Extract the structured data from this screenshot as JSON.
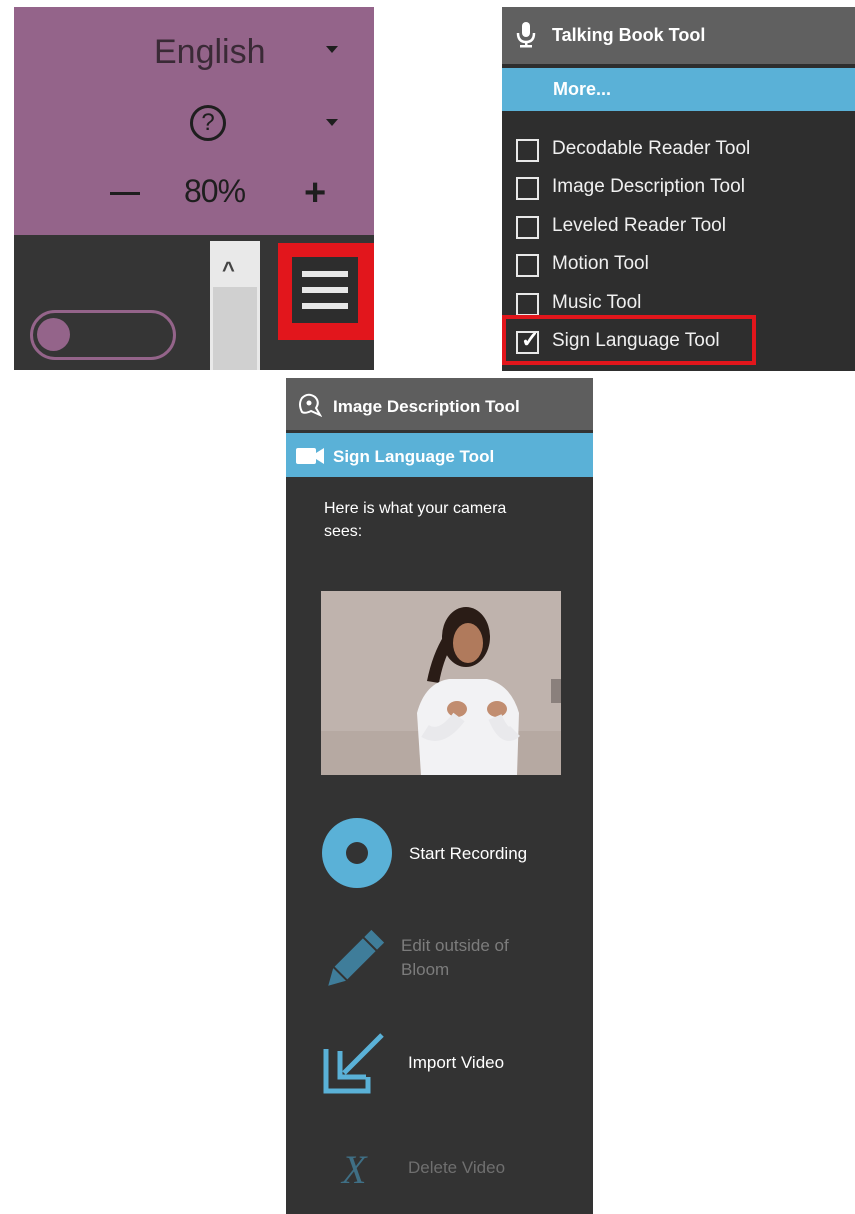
{
  "language_panel": {
    "language": "English",
    "help_glyph": "?",
    "zoom_minus": "—",
    "zoom_level": "80%",
    "zoom_plus": "+",
    "scroll_up_glyph": "^"
  },
  "tools_menu": {
    "header": "Talking Book Tool",
    "more": "More...",
    "items": [
      {
        "label": "Decodable Reader Tool",
        "checked": false
      },
      {
        "label": "Image Description Tool",
        "checked": false
      },
      {
        "label": "Leveled Reader Tool",
        "checked": false
      },
      {
        "label": "Motion Tool",
        "checked": false
      },
      {
        "label": "Music Tool",
        "checked": false
      },
      {
        "label": "Sign Language Tool",
        "checked": true
      }
    ],
    "check_glyph": "✓"
  },
  "sign_language_panel": {
    "header": "Image Description Tool",
    "active_tool": "Sign Language Tool",
    "camera_text": "Here is what your camera sees:",
    "buttons": {
      "start_recording": "Start Recording",
      "edit_outside": "Edit outside of Bloom",
      "import_video": "Import Video",
      "delete_video": "Delete Video"
    },
    "delete_glyph": "X"
  },
  "colors": {
    "accent_blue": "#5ab1d7",
    "bloom_purple": "#94648a",
    "highlight_red": "#e2161c",
    "panel_dark": "#333333",
    "disabled_text": "#7c7c7c"
  }
}
